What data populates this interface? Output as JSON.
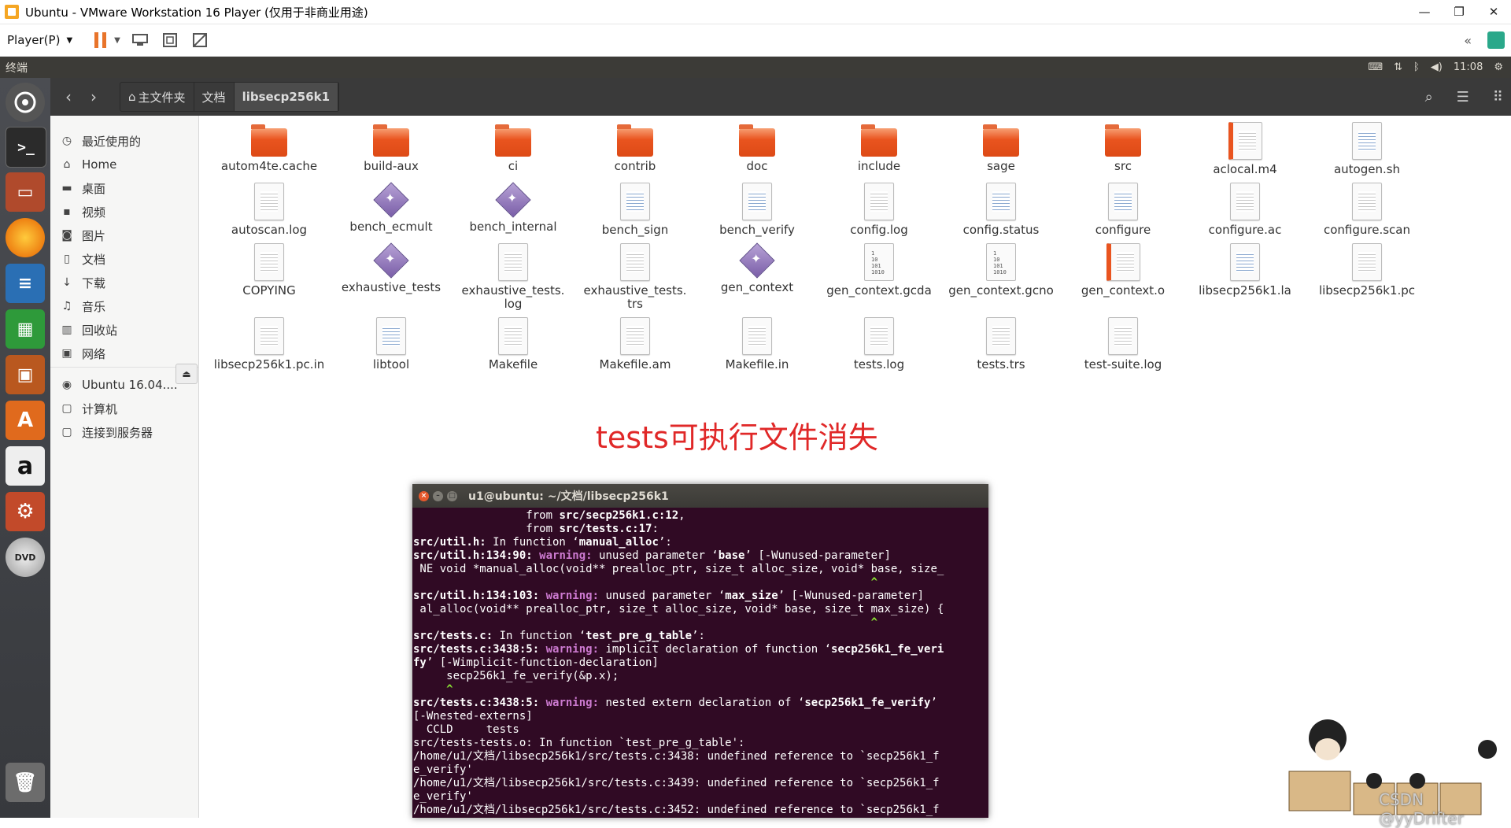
{
  "vm": {
    "title": "Ubuntu - VMware Workstation 16 Player (仅用于非商业用途)",
    "player_menu": "Player(P)",
    "minimize": "—",
    "restore": "❐",
    "close": "✕"
  },
  "panel": {
    "app_title": "终端",
    "time": "11:08"
  },
  "nautilus": {
    "breadcrumbs": [
      "主文件夹",
      "文档",
      "libsecp256k1"
    ]
  },
  "sidebar": {
    "items": [
      {
        "label": "最近使用的",
        "icon": "clock-icon"
      },
      {
        "label": "Home",
        "icon": "home-icon"
      },
      {
        "label": "桌面",
        "icon": "folder-icon"
      },
      {
        "label": "视频",
        "icon": "video-icon"
      },
      {
        "label": "图片",
        "icon": "camera-icon"
      },
      {
        "label": "文档",
        "icon": "document-icon"
      },
      {
        "label": "下载",
        "icon": "download-icon"
      },
      {
        "label": "音乐",
        "icon": "music-icon"
      },
      {
        "label": "回收站",
        "icon": "trash-icon"
      },
      {
        "label": "网络",
        "icon": "network-icon"
      },
      {
        "label": "Ubuntu 16.04....",
        "icon": "disc-icon"
      },
      {
        "label": "计算机",
        "icon": "computer-icon"
      },
      {
        "label": "连接到服务器",
        "icon": "server-icon"
      }
    ]
  },
  "files": [
    {
      "name": "autom4te.cache",
      "type": "folder"
    },
    {
      "name": "build-aux",
      "type": "folder"
    },
    {
      "name": "ci",
      "type": "folder"
    },
    {
      "name": "contrib",
      "type": "folder"
    },
    {
      "name": "doc",
      "type": "folder"
    },
    {
      "name": "include",
      "type": "folder"
    },
    {
      "name": "sage",
      "type": "folder"
    },
    {
      "name": "src",
      "type": "folder"
    },
    {
      "name": "aclocal.m4",
      "type": "doc-orange"
    },
    {
      "name": "autogen.sh",
      "type": "script"
    },
    {
      "name": "autoscan.log",
      "type": "doc"
    },
    {
      "name": "bench_ecmult",
      "type": "exe"
    },
    {
      "name": "bench_internal",
      "type": "exe"
    },
    {
      "name": "bench_sign",
      "type": "script"
    },
    {
      "name": "bench_verify",
      "type": "script"
    },
    {
      "name": "config.log",
      "type": "doc"
    },
    {
      "name": "config.status",
      "type": "script"
    },
    {
      "name": "configure",
      "type": "script"
    },
    {
      "name": "configure.ac",
      "type": "doc"
    },
    {
      "name": "configure.scan",
      "type": "doc"
    },
    {
      "name": "COPYING",
      "type": "doc"
    },
    {
      "name": "exhaustive_tests",
      "type": "exe"
    },
    {
      "name": "exhaustive_tests.\nlog",
      "type": "doc"
    },
    {
      "name": "exhaustive_tests.\ntrs",
      "type": "doc"
    },
    {
      "name": "gen_context",
      "type": "exe"
    },
    {
      "name": "gen_context.gcda",
      "type": "bin"
    },
    {
      "name": "gen_context.gcno",
      "type": "bin"
    },
    {
      "name": "gen_context.o",
      "type": "doc-orange"
    },
    {
      "name": "libsecp256k1.la",
      "type": "script"
    },
    {
      "name": "libsecp256k1.pc",
      "type": "doc"
    },
    {
      "name": "libsecp256k1.pc.in",
      "type": "doc"
    },
    {
      "name": "libtool",
      "type": "script"
    },
    {
      "name": "Makefile",
      "type": "doc"
    },
    {
      "name": "Makefile.am",
      "type": "doc"
    },
    {
      "name": "Makefile.in",
      "type": "doc"
    },
    {
      "name": "tests.log",
      "type": "doc"
    },
    {
      "name": "tests.trs",
      "type": "doc"
    },
    {
      "name": "test-suite.log",
      "type": "doc"
    }
  ],
  "annotation": "tests可执行文件消失",
  "terminal": {
    "title": "u1@ubuntu: ~/文档/libsecp256k1"
  },
  "watermark": "CSDN @yyDrifter"
}
